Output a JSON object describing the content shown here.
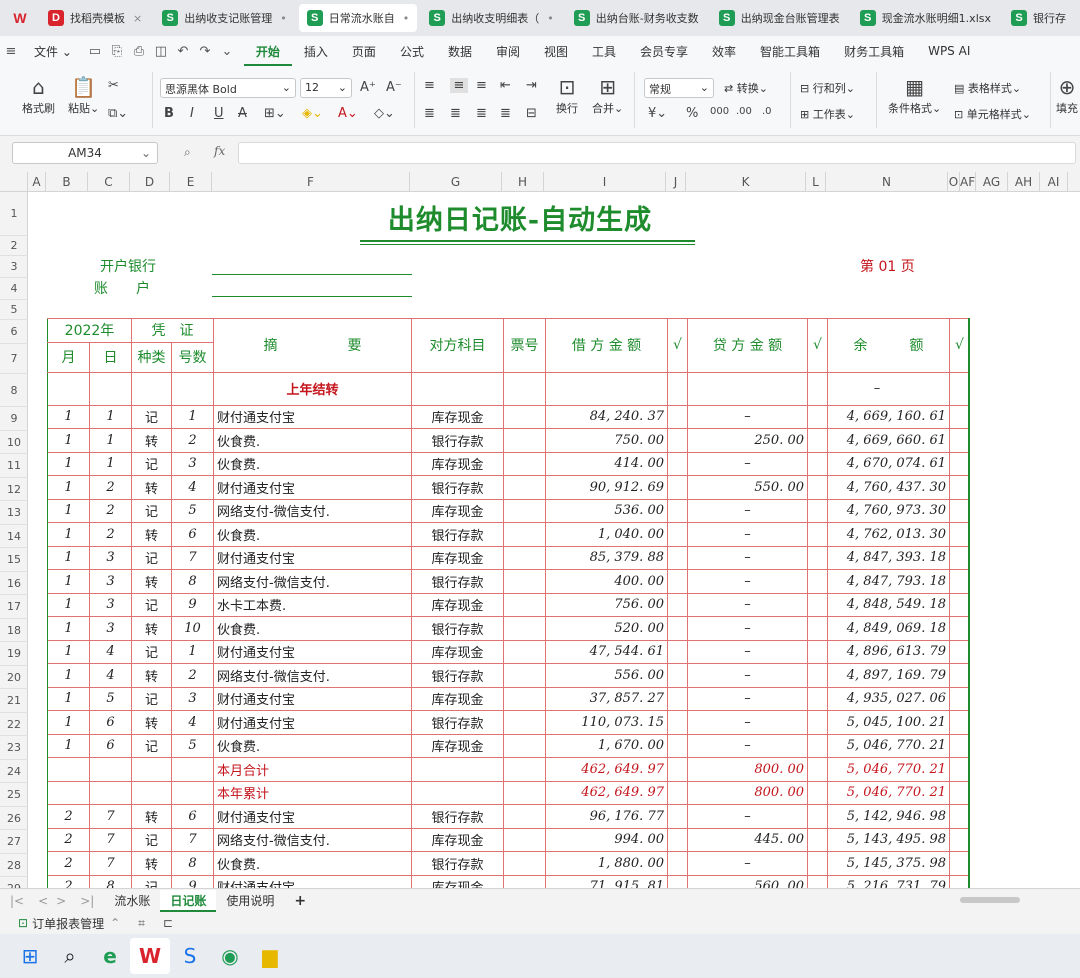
{
  "tabs": [
    {
      "label": "找稻壳模板",
      "icon": "docer-icon",
      "close": "×",
      "active": false
    },
    {
      "label": "出纳收支记账管理",
      "icon": "sheet-icon",
      "close": "•",
      "active": false
    },
    {
      "label": "日常流水账自",
      "icon": "sheet-icon",
      "close": "•",
      "active": true
    },
    {
      "label": "出纳收支明细表（",
      "icon": "sheet-icon",
      "close": "•",
      "active": false
    },
    {
      "label": "出纳台账-财务收支数",
      "icon": "sheet-icon",
      "close": "",
      "active": false
    },
    {
      "label": "出纳现金台账管理表",
      "icon": "sheet-icon",
      "close": "",
      "active": false
    },
    {
      "label": "现金流水账明细1.xlsx",
      "icon": "sheet-icon",
      "close": "",
      "active": false
    },
    {
      "label": "银行存",
      "icon": "sheet-icon",
      "close": "",
      "active": false
    }
  ],
  "menu": {
    "file": "文件",
    "items": [
      "开始",
      "插入",
      "页面",
      "公式",
      "数据",
      "审阅",
      "视图",
      "工具",
      "会员专享",
      "效率",
      "智能工具箱",
      "财务工具箱",
      "WPS AI"
    ],
    "active": "开始"
  },
  "ribbon": {
    "format_painter": "格式刷",
    "paste": "粘贴",
    "font_name": "思源黑体 Bold",
    "font_size": "12",
    "wrap": "换行",
    "merge": "合并",
    "number_format": "常规",
    "convert": "转换",
    "rows_cols": "行和列",
    "worksheet": "工作表",
    "cond_format": "条件格式",
    "table_style": "表格样式",
    "cell_style": "单元格样式",
    "fill": "填充"
  },
  "formula_bar": {
    "name_box": "AM34",
    "fx": "fx",
    "value": ""
  },
  "columns": [
    "A",
    "B",
    "C",
    "D",
    "E",
    "F",
    "G",
    "H",
    "I",
    "J",
    "K",
    "L",
    "N",
    "O",
    "AF",
    "AG",
    "AH",
    "AI"
  ],
  "rows": [
    "1",
    "2",
    "3",
    "4",
    "5",
    "6",
    "7",
    "8",
    "9",
    "10",
    "11",
    "12",
    "13",
    "14",
    "15",
    "16",
    "17",
    "18",
    "19",
    "20",
    "21",
    "22",
    "23",
    "24",
    "25",
    "26",
    "27",
    "28",
    "29"
  ],
  "sheet": {
    "title": "出纳日记账-自动生成",
    "bank_label": "开户银行",
    "account_label": "账　　户",
    "page_no": "第 01 页",
    "headers": {
      "year": "2022年",
      "voucher": "凭　证",
      "month": "月",
      "day": "日",
      "kind": "种类",
      "number": "号数",
      "summary": "摘　　　　　要",
      "account": "对方科目",
      "ticket": "票号",
      "debit": "借 方 金 额",
      "credit": "贷 方 金 额",
      "balance": "余　　　额",
      "check": "√"
    },
    "carry_row": {
      "summary": "上年结转",
      "balance": "–"
    },
    "rows": [
      {
        "m": "1",
        "d": "1",
        "k": "记",
        "n": "1",
        "s": "财付通支付宝",
        "acct": "库存现金",
        "debit": "84, 240. 37",
        "credit": "–",
        "bal": "4, 669, 160. 61"
      },
      {
        "m": "1",
        "d": "1",
        "k": "转",
        "n": "2",
        "s": "伙食费.",
        "acct": "银行存款",
        "debit": "750. 00",
        "credit": "250. 00",
        "bal": "4, 669, 660. 61"
      },
      {
        "m": "1",
        "d": "1",
        "k": "记",
        "n": "3",
        "s": "伙食费.",
        "acct": "库存现金",
        "debit": "414. 00",
        "credit": "–",
        "bal": "4, 670, 074. 61"
      },
      {
        "m": "1",
        "d": "2",
        "k": "转",
        "n": "4",
        "s": "财付通支付宝",
        "acct": "银行存款",
        "debit": "90, 912. 69",
        "credit": "550. 00",
        "bal": "4, 760, 437. 30"
      },
      {
        "m": "1",
        "d": "2",
        "k": "记",
        "n": "5",
        "s": "网络支付-微信支付.",
        "acct": "库存现金",
        "debit": "536. 00",
        "credit": "–",
        "bal": "4, 760, 973. 30"
      },
      {
        "m": "1",
        "d": "2",
        "k": "转",
        "n": "6",
        "s": "伙食费.",
        "acct": "银行存款",
        "debit": "1, 040. 00",
        "credit": "–",
        "bal": "4, 762, 013. 30"
      },
      {
        "m": "1",
        "d": "3",
        "k": "记",
        "n": "7",
        "s": "财付通支付宝",
        "acct": "库存现金",
        "debit": "85, 379. 88",
        "credit": "–",
        "bal": "4, 847, 393. 18"
      },
      {
        "m": "1",
        "d": "3",
        "k": "转",
        "n": "8",
        "s": "网络支付-微信支付.",
        "acct": "银行存款",
        "debit": "400. 00",
        "credit": "–",
        "bal": "4, 847, 793. 18"
      },
      {
        "m": "1",
        "d": "3",
        "k": "记",
        "n": "9",
        "s": "水卡工本费.",
        "acct": "库存现金",
        "debit": "756. 00",
        "credit": "–",
        "bal": "4, 848, 549. 18"
      },
      {
        "m": "1",
        "d": "3",
        "k": "转",
        "n": "10",
        "s": "伙食费.",
        "acct": "银行存款",
        "debit": "520. 00",
        "credit": "–",
        "bal": "4, 849, 069. 18"
      },
      {
        "m": "1",
        "d": "4",
        "k": "记",
        "n": "1",
        "s": "财付通支付宝",
        "acct": "库存现金",
        "debit": "47, 544. 61",
        "credit": "–",
        "bal": "4, 896, 613. 79"
      },
      {
        "m": "1",
        "d": "4",
        "k": "转",
        "n": "2",
        "s": "网络支付-微信支付.",
        "acct": "银行存款",
        "debit": "556. 00",
        "credit": "–",
        "bal": "4, 897, 169. 79"
      },
      {
        "m": "1",
        "d": "5",
        "k": "记",
        "n": "3",
        "s": "财付通支付宝",
        "acct": "库存现金",
        "debit": "37, 857. 27",
        "credit": "–",
        "bal": "4, 935, 027. 06"
      },
      {
        "m": "1",
        "d": "6",
        "k": "转",
        "n": "4",
        "s": "财付通支付宝",
        "acct": "银行存款",
        "debit": "110, 073. 15",
        "credit": "–",
        "bal": "5, 045, 100. 21"
      },
      {
        "m": "1",
        "d": "6",
        "k": "记",
        "n": "5",
        "s": "伙食费.",
        "acct": "库存现金",
        "debit": "1, 670. 00",
        "credit": "–",
        "bal": "5, 046, 770. 21"
      }
    ],
    "month_total": {
      "s": "本月合计",
      "debit": "462, 649. 97",
      "credit": "800. 00",
      "bal": "5, 046, 770. 21"
    },
    "year_total": {
      "s": "本年累计",
      "debit": "462, 649. 97",
      "credit": "800. 00",
      "bal": "5, 046, 770. 21"
    },
    "rows2": [
      {
        "m": "2",
        "d": "7",
        "k": "转",
        "n": "6",
        "s": "财付通支付宝",
        "acct": "银行存款",
        "debit": "96, 176. 77",
        "credit": "–",
        "bal": "5, 142, 946. 98"
      },
      {
        "m": "2",
        "d": "7",
        "k": "记",
        "n": "7",
        "s": "网络支付-微信支付.",
        "acct": "库存现金",
        "debit": "994. 00",
        "credit": "445. 00",
        "bal": "5, 143, 495. 98"
      },
      {
        "m": "2",
        "d": "7",
        "k": "转",
        "n": "8",
        "s": "伙食费.",
        "acct": "银行存款",
        "debit": "1, 880. 00",
        "credit": "–",
        "bal": "5, 145, 375. 98"
      },
      {
        "m": "2",
        "d": "8",
        "k": "记",
        "n": "9",
        "s": "财付通支付宝",
        "acct": "库存现金",
        "debit": "71, 915. 81",
        "credit": "560. 00",
        "bal": "5, 216, 731. 79"
      }
    ]
  },
  "sheet_tabs": [
    "流水账",
    "日记账",
    "使用说明"
  ],
  "active_sheet": "日记账",
  "add_sheet": "+",
  "status": {
    "report_mgr": "订单报表管理"
  },
  "colors": {
    "green": "#1e8c2d",
    "red": "#c4141c",
    "accent": "#1f8a3b"
  }
}
